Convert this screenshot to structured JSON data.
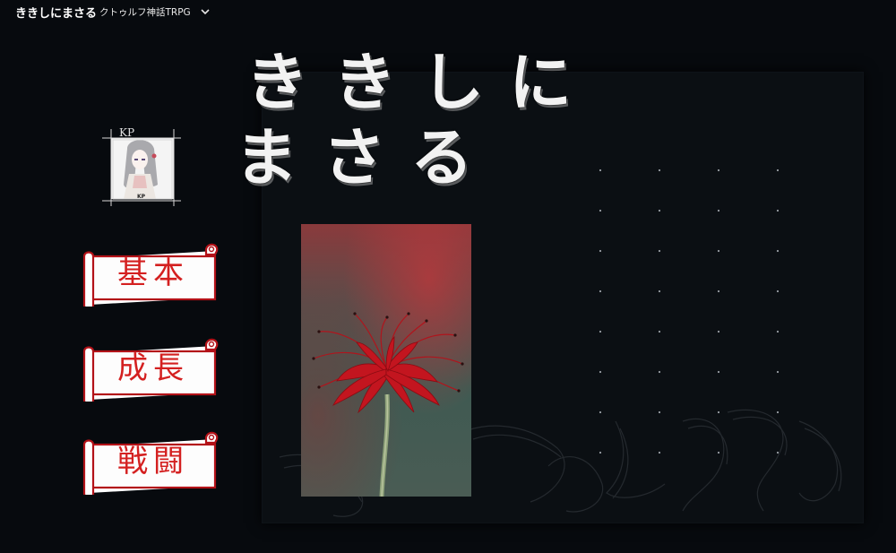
{
  "header": {
    "title": "ききしにまさる",
    "subtitle": "クトゥルフ神話TRPG"
  },
  "hero": {
    "title_line1": "ききしに",
    "title_line2": "まさる"
  },
  "kp": {
    "label": "KP",
    "badge": "KP"
  },
  "menu": {
    "items": [
      {
        "label": "基本"
      },
      {
        "label": "成長"
      },
      {
        "label": "戦闘"
      }
    ]
  },
  "colors": {
    "background": "#070a0e",
    "panel": "#0b0f13",
    "accent_red": "#d42020",
    "scroll_border": "#b31218"
  }
}
